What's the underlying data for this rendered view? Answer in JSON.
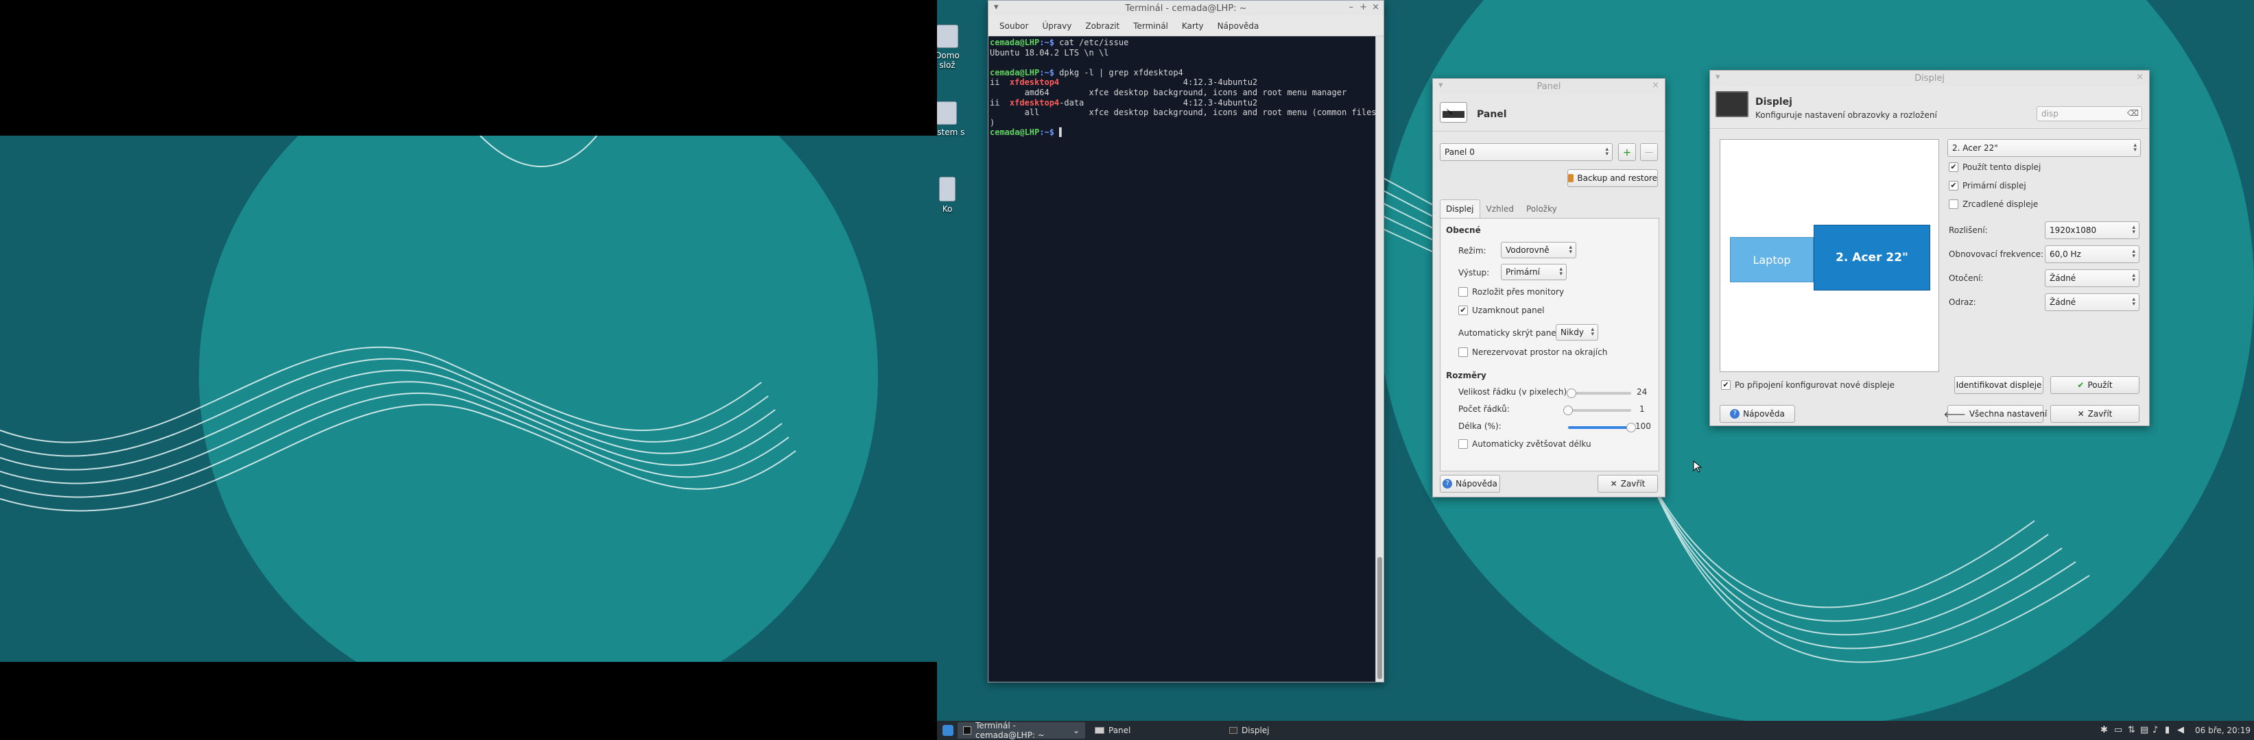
{
  "desktop": {
    "icons": [
      {
        "name": "home-folder-icon",
        "label": "Domovská složka"
      },
      {
        "name": "file-system-icon",
        "label": "Systém souborů"
      },
      {
        "name": "trash-icon",
        "label": "Koš"
      }
    ],
    "icon_partial_labels": [
      "Domo",
      "slož",
      "System s",
      "Ko"
    ]
  },
  "terminal": {
    "title": "Terminál - cemada@LHP: ~",
    "menu": [
      "Soubor",
      "Úpravy",
      "Zobrazit",
      "Terminál",
      "Karty",
      "Nápověda"
    ],
    "lines": [
      {
        "prompt_user": "cemada@LHP",
        "prompt_path": ":~$",
        "cmd": " cat /etc/issue"
      },
      {
        "text": "Ubuntu 18.04.2 LTS \\n \\l"
      },
      {
        "text": ""
      },
      {
        "prompt_user": "cemada@LHP",
        "prompt_path": ":~$",
        "cmd": " dpkg -l | grep xfdesktop4"
      },
      {
        "pre": "ii  ",
        "red": "xfdesktop4",
        "post": "                         4:12.3-4ubuntu2"
      },
      {
        "text": "       amd64        xfce desktop background, icons and root menu manager"
      },
      {
        "pre": "ii  ",
        "red": "xfdesktop4",
        "post": "-data                    4:12.3-4ubuntu2"
      },
      {
        "text": "       all          xfce desktop background, icons and root menu (common files"
      },
      {
        "text": ")"
      },
      {
        "prompt_user": "cemada@LHP",
        "prompt_path": ":~$",
        "cmd": " ▌"
      }
    ]
  },
  "panel_win": {
    "title": "Panel",
    "header": "Panel",
    "panel_select": "Panel 0",
    "backup_button": "Backup and restore",
    "tabs": [
      "Displej",
      "Vzhled",
      "Položky"
    ],
    "section_general": "Obecné",
    "mode_label": "Režim:",
    "mode_value": "Vodorovně",
    "output_label": "Výstup:",
    "output_value": "Primární",
    "span_monitors": "Rozložit přes monitory",
    "lock_panel": "Uzamknout panel",
    "autohide_label": "Automaticky skrýt panel:",
    "autohide_value": "Nikdy",
    "no_reserve": "Nerezervovat prostor na okrajích",
    "section_dimensions": "Rozměry",
    "row_size_label": "Velikost řádku (v pixelech):",
    "row_size_value": "24",
    "row_size_fraction": 0.05,
    "row_count_label": "Počet řádků:",
    "row_count_value": "1",
    "row_count_fraction": 0.0,
    "length_label": "Délka (%):",
    "length_value": "100",
    "length_fraction": 1.0,
    "auto_length": "Automaticky zvětšovat délku",
    "help_button": "Nápověda",
    "close_button": "Zavřít",
    "checks": {
      "span_monitors": false,
      "lock_panel": true,
      "no_reserve": false,
      "auto_length": false
    }
  },
  "display_win": {
    "title": "Displej",
    "header": "Displej",
    "subtitle": "Konfiguruje nastavení obrazovky a rozložení",
    "search_placeholder": "disp",
    "display_select": "2. Acer 22\"",
    "use_display": "Použít tento displej",
    "primary_display": "Primární displej",
    "mirror_displays": "Zrcadlené displeje",
    "resolution_label": "Rozlišení:",
    "resolution_value": "1920x1080",
    "refresh_label": "Obnovovací frekvence:",
    "refresh_value": "60,0 Hz",
    "rotation_label": "Otočení:",
    "rotation_value": "Žádné",
    "reflection_label": "Odraz:",
    "reflection_value": "Žádné",
    "laptop_label": "Laptop",
    "acer_label": "2. Acer 22\"",
    "auto_configure": "Po připojení konfigurovat nové displeje",
    "identify_button": "Identifikovat displeje",
    "apply_button": "Použít",
    "help_button": "Nápověda",
    "all_settings_button": "Všechna nastavení",
    "close_button": "Zavřít",
    "checks": {
      "use_display": true,
      "primary_display": true,
      "mirror_displays": false,
      "auto_configure": true
    }
  },
  "taskbar": {
    "tasks": [
      {
        "label": "Terminál - cemada@LHP: ~",
        "active": true
      },
      {
        "label": "Panel",
        "active": false
      },
      {
        "label": "Displej",
        "active": false
      }
    ],
    "clock": "06 bře, 20:19"
  },
  "colors": {
    "wallpaper": "#125f6a",
    "wallpaper_circle": "#1a8a8c",
    "terminal_bg": "#121826",
    "prompt_user": "#5fd35f",
    "prompt_path": "#6e9cff",
    "grep_match": "#ff5a5a",
    "acer_display": "#1a80c8",
    "laptop_display": "#64b4e8",
    "taskbar": "#242a31"
  }
}
